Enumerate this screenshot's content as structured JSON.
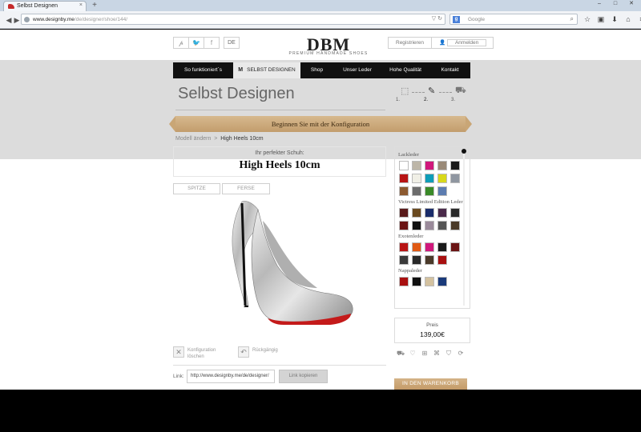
{
  "browser": {
    "tab_title": "Selbst Designen",
    "tab_close": "×",
    "new_tab": "+",
    "window_buttons": [
      "–",
      "□",
      "✕"
    ],
    "url_host": "www.designby.me",
    "url_path": "/de/designer/shoe/144/",
    "search_engine": "g",
    "search_placeholder": "Google",
    "nav_icons": [
      "back-icon",
      "forward-icon",
      "reload-icon",
      "search-icon",
      "star-icon",
      "clipboard-icon",
      "download-icon",
      "home-icon",
      "menu-icon"
    ]
  },
  "header": {
    "social": [
      "𝓅",
      "🐦",
      "f"
    ],
    "language": "DE",
    "logo": "DBM",
    "tagline": "PREMIUM HANDMADE SHOES",
    "register": "Registrieren",
    "login": "Anmelden"
  },
  "menu": [
    {
      "label": "So funktioniert´s",
      "active": false
    },
    {
      "label": "SELBST DESIGNEN",
      "active": true
    },
    {
      "label": "Shop",
      "active": false
    },
    {
      "label": "Unser Leder",
      "active": false
    },
    {
      "label": "Hohe Qualität",
      "active": false
    },
    {
      "label": "Kontakt",
      "active": false
    }
  ],
  "page_title": "Selbst Designen",
  "steps": [
    "1.",
    "2.",
    "3."
  ],
  "banner": "Beginnen Sie mit der Konfiguration",
  "breadcrumb": {
    "parent": "Modell ändern",
    "sep": ">",
    "current": "High Heels 10cm"
  },
  "shoe": {
    "subtitle": "Ihr perfekter Schuh:",
    "name": "High Heels 10cm"
  },
  "views": [
    "SPITZE",
    "FERSE"
  ],
  "actions": {
    "delete": "Konfiguration löschen",
    "undo": "Rückgängig"
  },
  "link": {
    "label": "Link:",
    "value": "http://www.designby.me/de/designer/",
    "copy": "Link kopieren"
  },
  "palette": [
    {
      "name": "Lackleder",
      "colors": [
        "#ffffff",
        "#bdb6a8",
        "#d0187c",
        "#9a8a78",
        "#1a1a1a",
        "#b81414",
        "#f0efe6",
        "#0e9db8",
        "#d8d81a",
        "#8f96a0",
        "#8c5a30",
        "#6c6c6c",
        "#3a8a28",
        "#5c7cb0"
      ]
    },
    {
      "name": "Victress Limited Edition Leder",
      "colors": [
        "#5a1a1a",
        "#6a4a20",
        "#1a2c6a",
        "#4a2a4a",
        "#2a2a2a",
        "#6a1414",
        "#111111",
        "#9a8a9a",
        "#555555",
        "#4a3a28"
      ]
    },
    {
      "name": "Exotenleder",
      "colors": [
        "#b81414",
        "#e05a14",
        "#d0187c",
        "#1a1a1a",
        "#6a1414",
        "#3a3a3a",
        "#2a2a2a",
        "#4a3a2a",
        "#a81010"
      ]
    },
    {
      "name": "Nappaleder",
      "colors": [
        "#a81010",
        "#111111",
        "#d4c2a0",
        "#1a3a7a"
      ]
    }
  ],
  "price": {
    "label": "Preis",
    "value": "139,00€"
  },
  "features": [
    "truck-icon",
    "heart-icon",
    "cart-icon",
    "gift-icon",
    "shield-icon",
    "refresh-icon"
  ],
  "cart_button": "IN DEN WARENKORB"
}
